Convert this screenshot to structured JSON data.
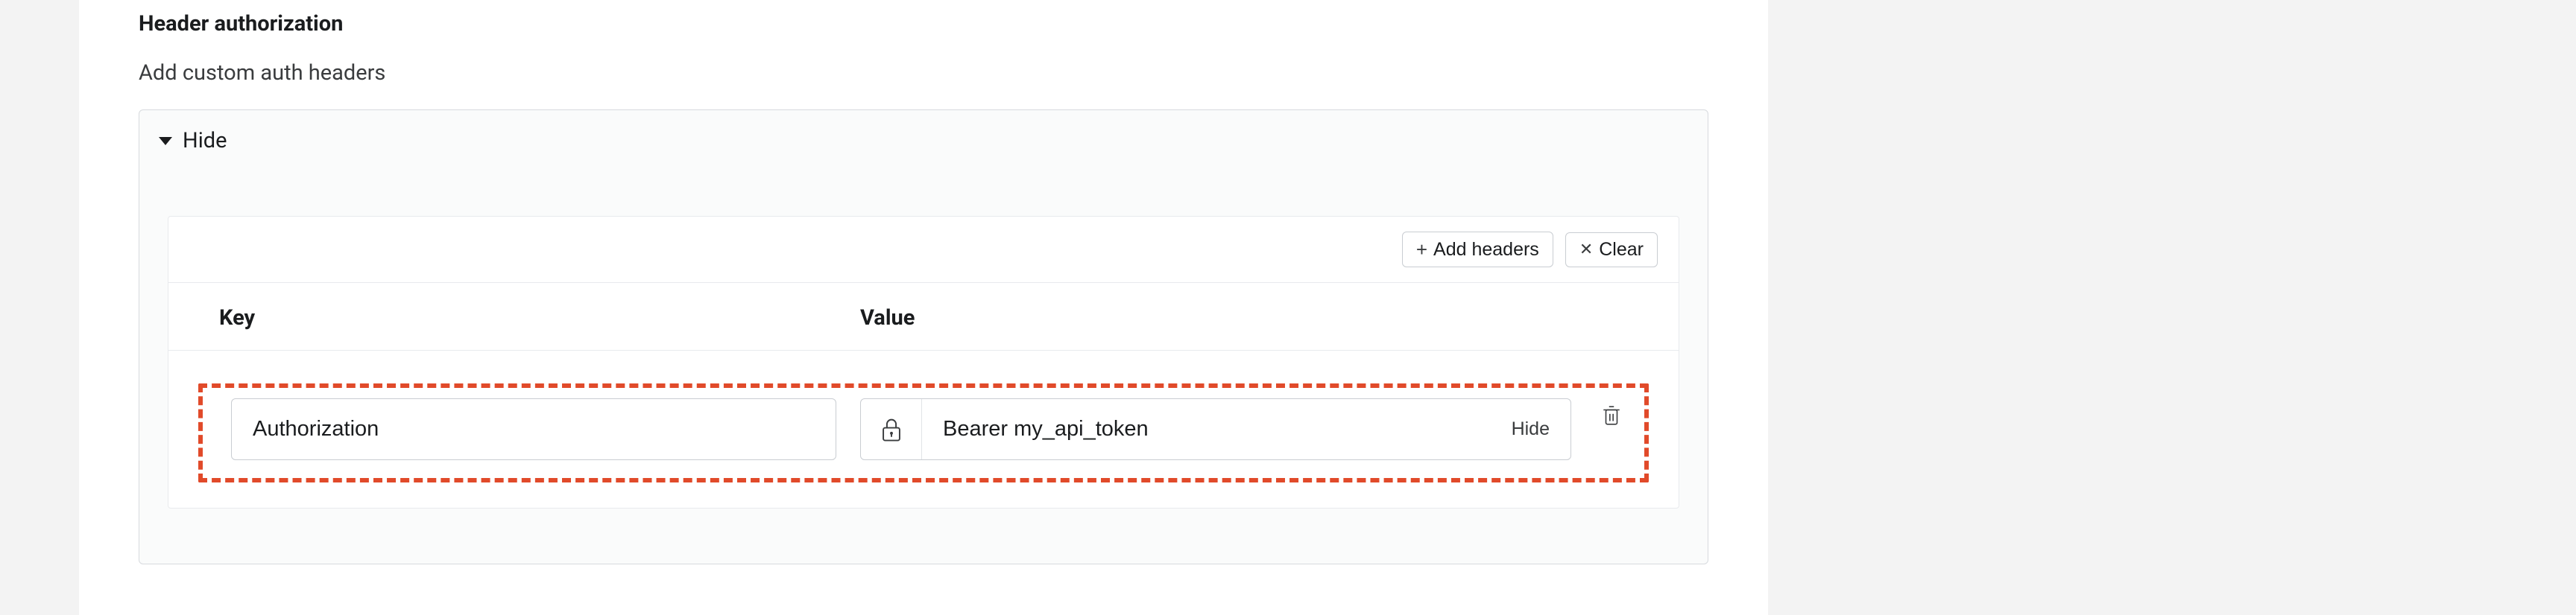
{
  "section": {
    "title": "Header authorization",
    "subtitle": "Add custom auth headers",
    "toggle_label": "Hide"
  },
  "actions": {
    "add_label": "Add headers",
    "clear_label": "Clear"
  },
  "table": {
    "key_header": "Key",
    "value_header": "Value"
  },
  "row": {
    "key": "Authorization",
    "value": "Bearer my_api_token",
    "hide_label": "Hide"
  }
}
